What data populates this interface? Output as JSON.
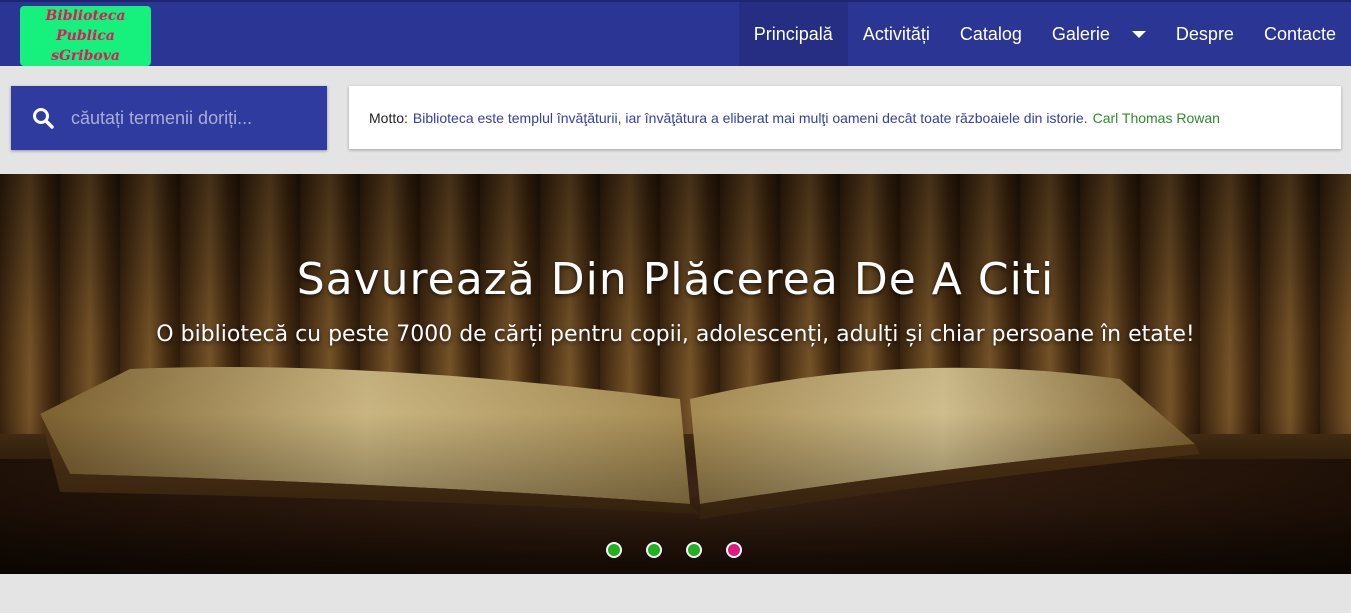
{
  "logo": {
    "line1": "Biblioteca Publica",
    "line2": "sGribova"
  },
  "nav": {
    "items": [
      {
        "label": "Principală",
        "active": true
      },
      {
        "label": "Activități"
      },
      {
        "label": "Catalog"
      },
      {
        "label": "Galerie",
        "has_dropdown": true
      },
      {
        "label": "Despre"
      },
      {
        "label": "Contacte"
      }
    ]
  },
  "search": {
    "placeholder": "căutați termenii doriți...",
    "icon": "search-icon"
  },
  "motto": {
    "label": "Motto:",
    "quote": "Biblioteca este templul învăţăturii, iar învăţătura a eliberat mai mulţi oameni decât toate războaiele din istorie.",
    "author": "Carl Thomas Rowan"
  },
  "hero": {
    "title": "Savurează Din Plăcerea De A Citi",
    "subtitle": "O bibliotecă cu peste 7000 de cărți pentru copii, adolescenți, adulți și chiar persoane în etate!",
    "slide_count": 4,
    "active_slide": 4
  },
  "colors": {
    "navbar": "#2b3593",
    "logo_bg": "#16f07d",
    "logo_text": "#e0175a",
    "quote": "#3441a6",
    "author": "#2e8b2e",
    "dot": "#1fb11f",
    "dot_active": "#e01a7a"
  }
}
